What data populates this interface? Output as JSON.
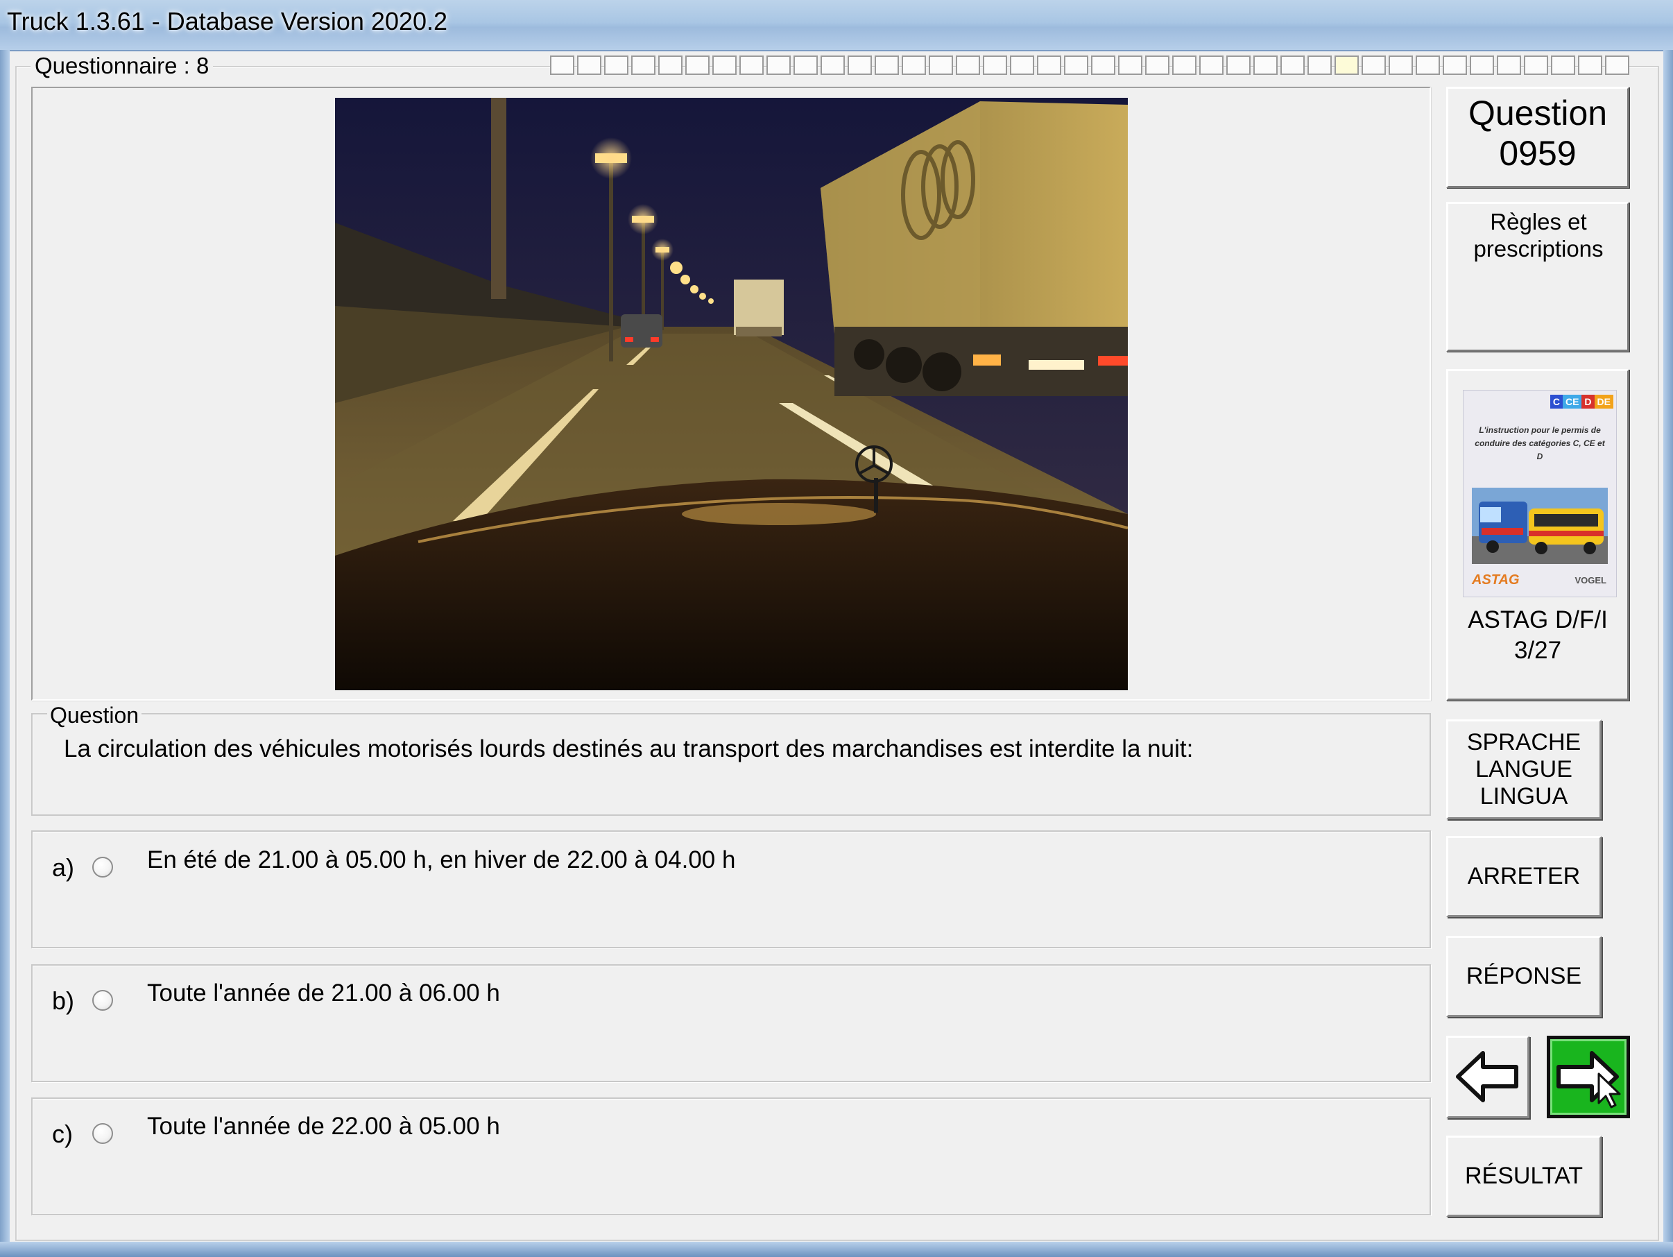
{
  "window": {
    "title": "Truck 1.3.61 - Database Version 2020.2"
  },
  "questionnaire": {
    "label": "Questionnaire : 8",
    "progress_total": 40,
    "progress_current_index": 29
  },
  "question_panel": {
    "label": "Question",
    "number": "0959"
  },
  "category": {
    "text": "Règles et prescriptions"
  },
  "book": {
    "tags": [
      {
        "text": "C",
        "color": "#2c4fd1"
      },
      {
        "text": "CE",
        "color": "#3fa9e8"
      },
      {
        "text": "D",
        "color": "#d7322c"
      },
      {
        "text": "DE",
        "color": "#f2a31b"
      }
    ],
    "cover_text": "L'instruction pour le permis de conduire des catégories C, CE et D",
    "publisher_left": "ASTAG",
    "publisher_right": "VOGEL",
    "label_line1": "ASTAG D/F/I",
    "label_line2": "3/27"
  },
  "question": {
    "section_label": "Question",
    "text": "La circulation des véhicules motorisés lourds destinés au transport des marchandises est interdite la nuit:"
  },
  "answers": [
    {
      "letter": "a)",
      "text": "En été de 21.00 à 05.00 h, en hiver de 22.00 à 04.00 h"
    },
    {
      "letter": "b)",
      "text": "Toute l'année de 21.00 à 06.00 h"
    },
    {
      "letter": "c)",
      "text": "Toute l'année de 22.00 à 05.00 h"
    }
  ],
  "buttons": {
    "language_line1": "SPRACHE",
    "language_line2": "LANGUE",
    "language_line3": "LINGUA",
    "stop": "ARRETER",
    "answer": "RÉPONSE",
    "result": "RÉSULTAT",
    "prev_icon": "arrow-left-icon",
    "next_icon": "arrow-right-icon"
  },
  "colors": {
    "next_button": "#19b51e",
    "photo_sky": "#1d1c3a",
    "photo_lights": "#e7b43d"
  }
}
